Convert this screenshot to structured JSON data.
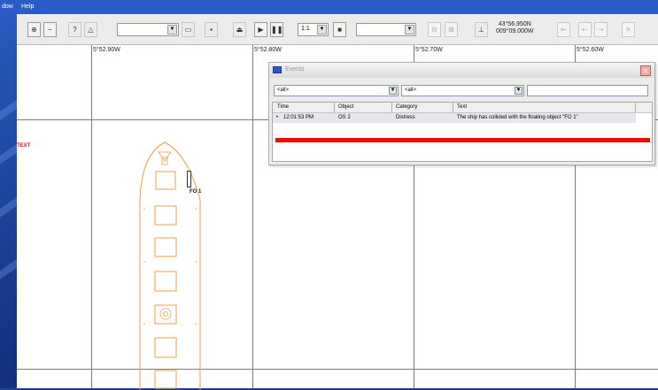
{
  "menubar": {
    "items": [
      "dow",
      "Help"
    ]
  },
  "toolbar": {
    "buttons": [
      {
        "name": "pan-button",
        "glyph": "⊕"
      },
      {
        "name": "zoom-out-button",
        "glyph": "−"
      },
      {
        "name": "help-cursor-button",
        "glyph": "?"
      },
      {
        "name": "measure-button",
        "glyph": "△"
      }
    ],
    "speed": "1:1",
    "coords": {
      "lat": "43°56.950N",
      "lon": "009°09.000W"
    }
  },
  "chart": {
    "longitudes": [
      "5°52.90W",
      "5°52.80W",
      "5°52.70W",
      "5°52.60W"
    ],
    "text_label": "TEXT",
    "object_label": "FO 1"
  },
  "dialog": {
    "title": "Events",
    "close": "×",
    "filters": [
      "<all>",
      "<all>"
    ],
    "columns": [
      "Time",
      "Object",
      "Category",
      "Text"
    ],
    "rows": [
      {
        "time": "12:01:53 PM",
        "object": "OS 2",
        "category": "Distress",
        "text": "The ship has collided with the floating object \"FO 1\""
      }
    ]
  },
  "colors": {
    "alert": "#ee0a0a",
    "ship_outline": "#e8a04a",
    "label_red": "#d81818"
  }
}
